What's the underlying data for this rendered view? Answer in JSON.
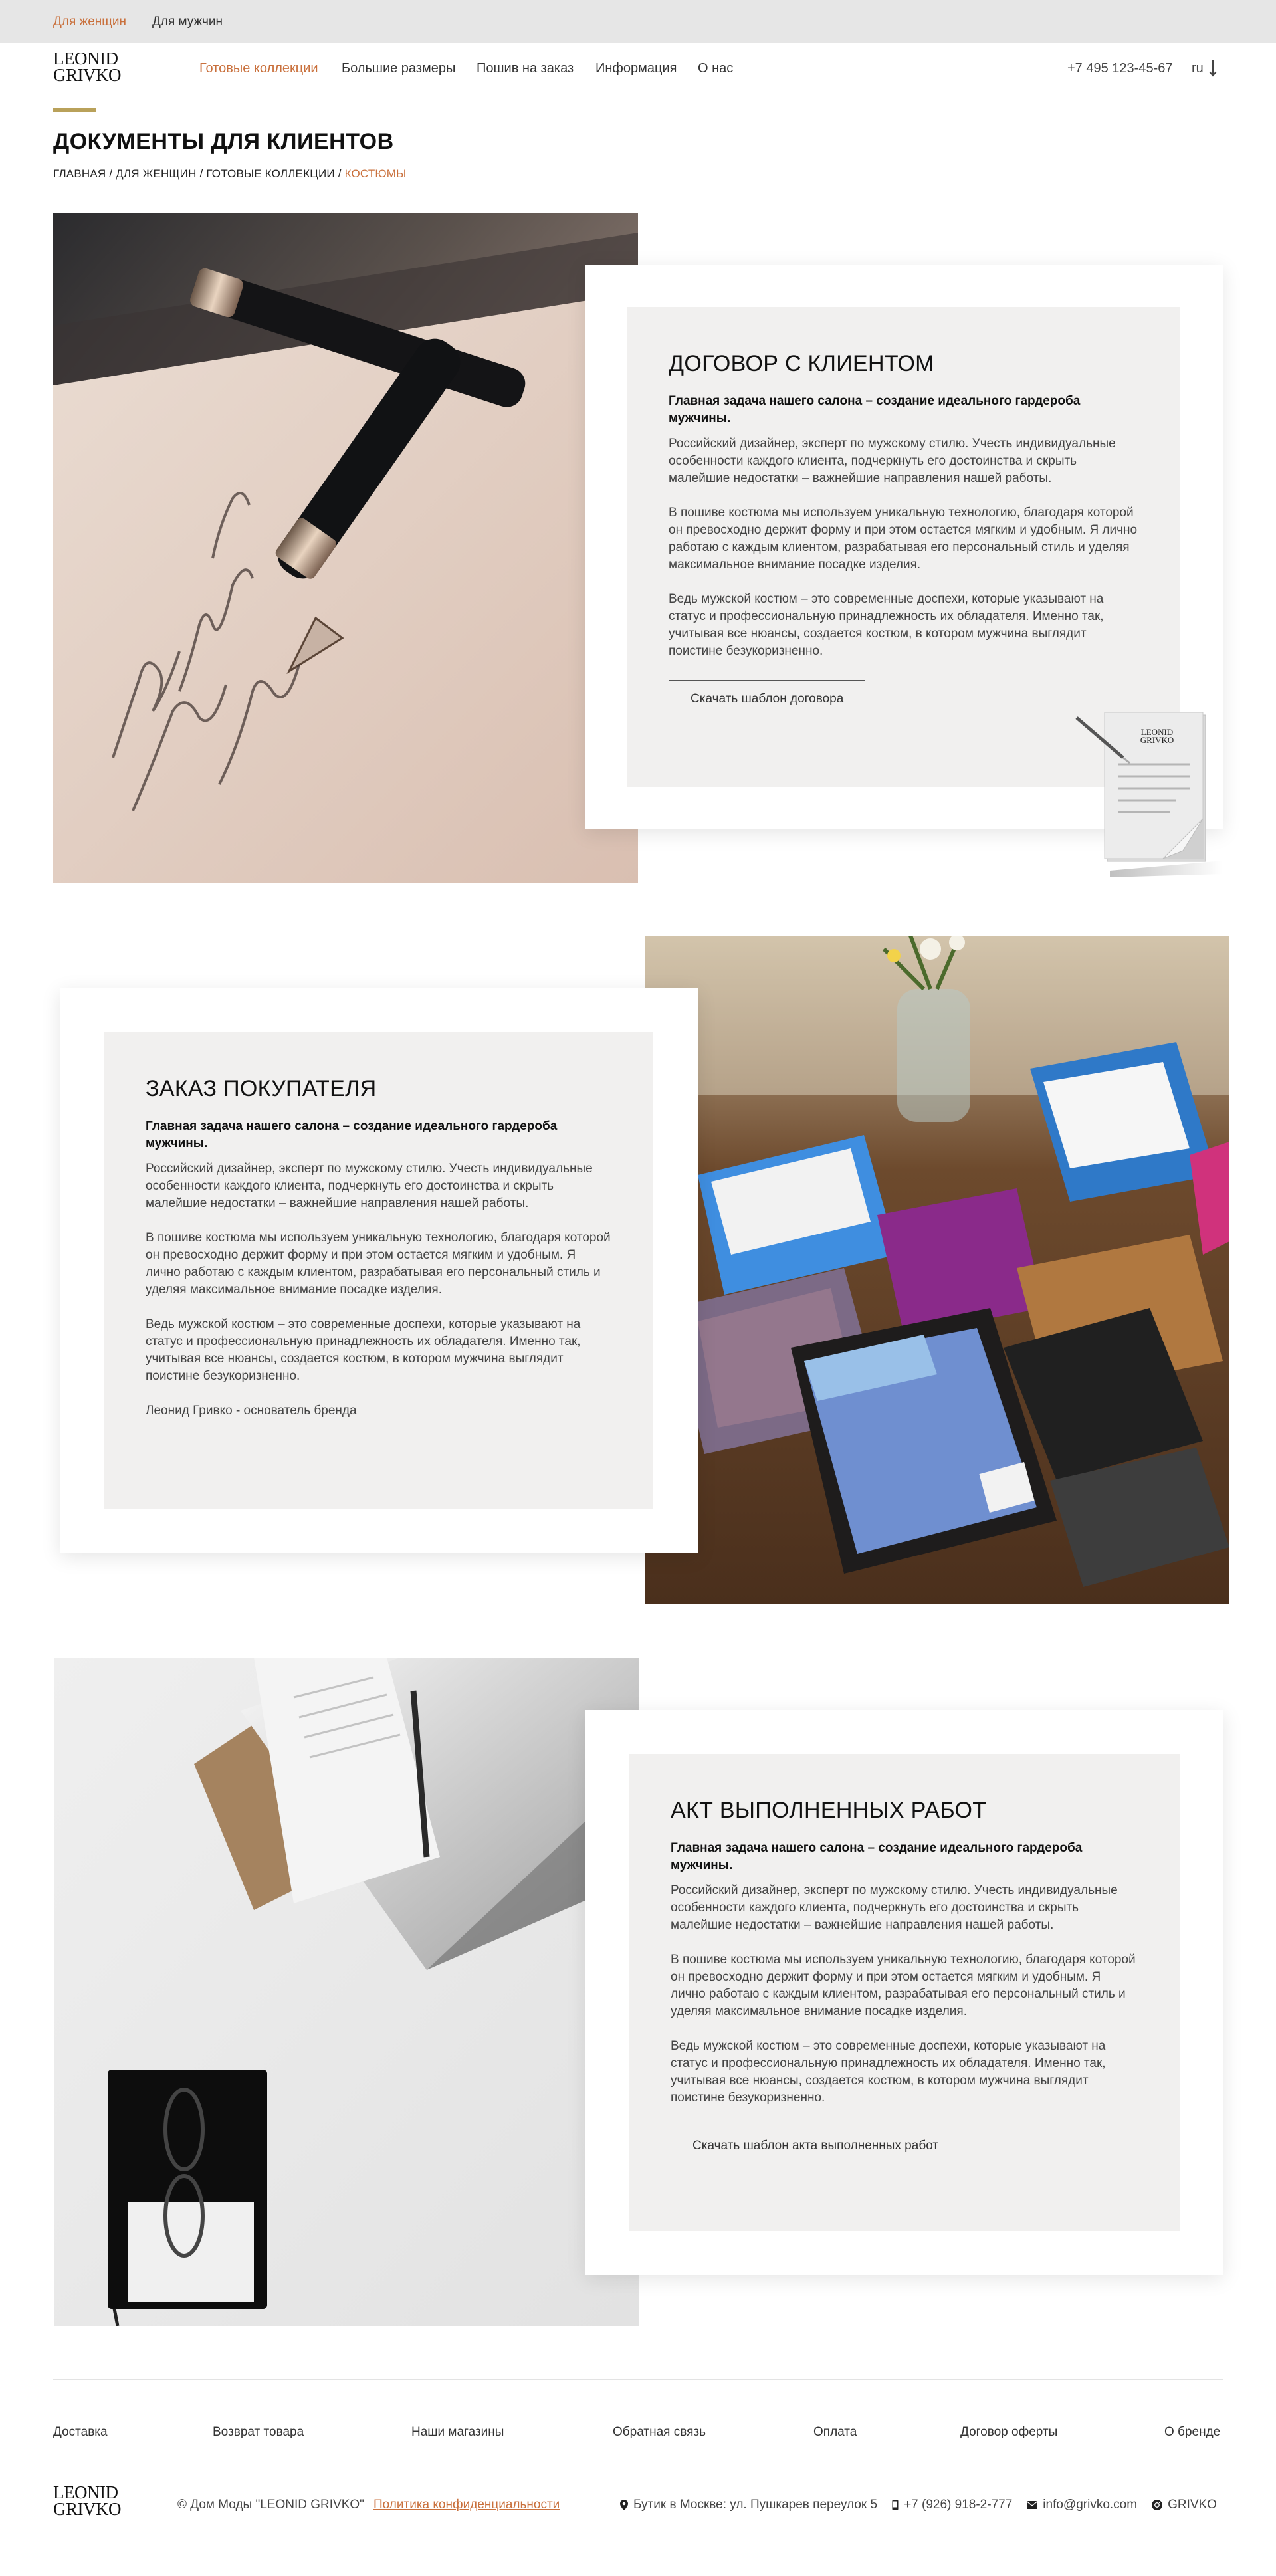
{
  "topbar": {
    "women": "Для женщин",
    "men": "Для мужчин"
  },
  "logo": {
    "line1": "LEONID",
    "line2": "GRIVKO"
  },
  "nav": {
    "items": [
      "Готовые коллекции",
      "Большие размеры",
      "Пошив на заказ",
      "Информация",
      "О нас"
    ],
    "active_index": 0
  },
  "header": {
    "phone": "+7 495 123-45-67",
    "lang": "ru"
  },
  "page": {
    "title": "ДОКУМЕНТЫ ДЛЯ КЛИЕНТОВ"
  },
  "breadcrumb": {
    "path": "ГЛАВНАЯ / ДЛЯ ЖЕНЩИН / ГОТОВЫЕ КОЛЛЕКЦИИ / ",
    "current": "КОСТЮМЫ"
  },
  "sections": [
    {
      "title": "ДОГОВОР С КЛИЕНТОМ",
      "lead": "Главная задача нашего салона – создание идеального гардероба мужчины.",
      "p1": "Российский дизайнер, эксперт по мужскому стилю. Учесть индивидуальные особенности каждого клиента, подчеркнуть его достоинства и скрыть малейшие недостатки – важнейшие направления нашей работы.",
      "p2": "В пошиве костюма мы используем уникальную технологию, благодаря которой он превосходно держит форму и при этом остается мягким и удобным. Я лично работаю с каждым клиентом, разрабатывая его персональный стиль и уделяя максимальное внимание посадке изделия.",
      "p3": "Ведь мужской костюм – это современные доспехи, которые указывают на статус и профессиональную принадлежность их обладателя. Именно так, учитывая все нюансы, создается костюм, в котором мужчина выглядит поистине безукоризненно.",
      "button": "Скачать шаблон договора",
      "doc_logo_1": "LEONID",
      "doc_logo_2": "GRIVKO"
    },
    {
      "title": "ЗАКАЗ ПОКУПАТЕЛЯ",
      "lead": "Главная задача нашего салона – создание идеального гардероба мужчины.",
      "p1": "Российский дизайнер, эксперт по мужскому стилю. Учесть индивидуальные особенности каждого клиента, подчеркнуть его достоинства и скрыть малейшие недостатки – важнейшие направления нашей работы.",
      "p2": "В пошиве костюма мы используем уникальную технологию, благодаря которой он превосходно держит форму и при этом остается мягким и удобным. Я лично работаю с каждым клиентом, разрабатывая его персональный стиль и уделяя максимальное внимание посадке изделия.",
      "p3": "Ведь мужской костюм – это современные доспехи, которые указывают на статус и профессиональную принадлежность их обладателя. Именно так, учитывая все нюансы, создается костюм, в котором мужчина выглядит поистине безукоризненно.",
      "signature": "Леонид Гривко - основатель бренда"
    },
    {
      "title": "АКТ ВЫПОЛНЕННЫХ РАБОТ",
      "lead": "Главная задача нашего салона – создание идеального гардероба мужчины.",
      "p1": "Российский дизайнер, эксперт по мужскому стилю. Учесть индивидуальные особенности каждого клиента, подчеркнуть его достоинства и скрыть малейшие недостатки – важнейшие направления нашей работы.",
      "p2": "В пошиве костюма мы используем уникальную технологию, благодаря которой он превосходно держит форму и при этом остается мягким и удобным. Я лично работаю с каждым клиентом, разрабатывая его персональный стиль и уделяя максимальное внимание посадке изделия.",
      "p3": "Ведь мужской костюм – это современные доспехи, которые указывают на статус и профессиональную принадлежность их обладателя. Именно так, учитывая все нюансы, создается костюм, в котором мужчина выглядит поистине безукоризненно.",
      "button": "Скачать шаблон акта выполненных работ"
    }
  ],
  "footer": {
    "links": [
      "Доставка",
      "Возврат товара",
      "Наши магазины",
      "Обратная связь",
      "Оплата",
      "Договор оферты",
      "О бренде"
    ],
    "copyright": "© Дом Моды \"LEONID GRIVKO\"",
    "policy": "Политика конфиденциальности",
    "address": "Бутик в Москве: ул. Пушкарев переулок 5",
    "phone": "+7 (926) 918-2-777",
    "email": "info@grivko.com",
    "social": "GRIVKO"
  },
  "icons": {
    "lang_arrow": "arrow-down-icon",
    "address": "map-pin-icon",
    "phone": "mobile-phone-icon",
    "email": "envelope-icon",
    "social": "instagram-icon"
  },
  "colors": {
    "accent": "#c9703c",
    "gold_line": "#b9a15a",
    "topbar_bg": "#e6e6e6",
    "card_inner_bg": "#f1f0ef"
  }
}
